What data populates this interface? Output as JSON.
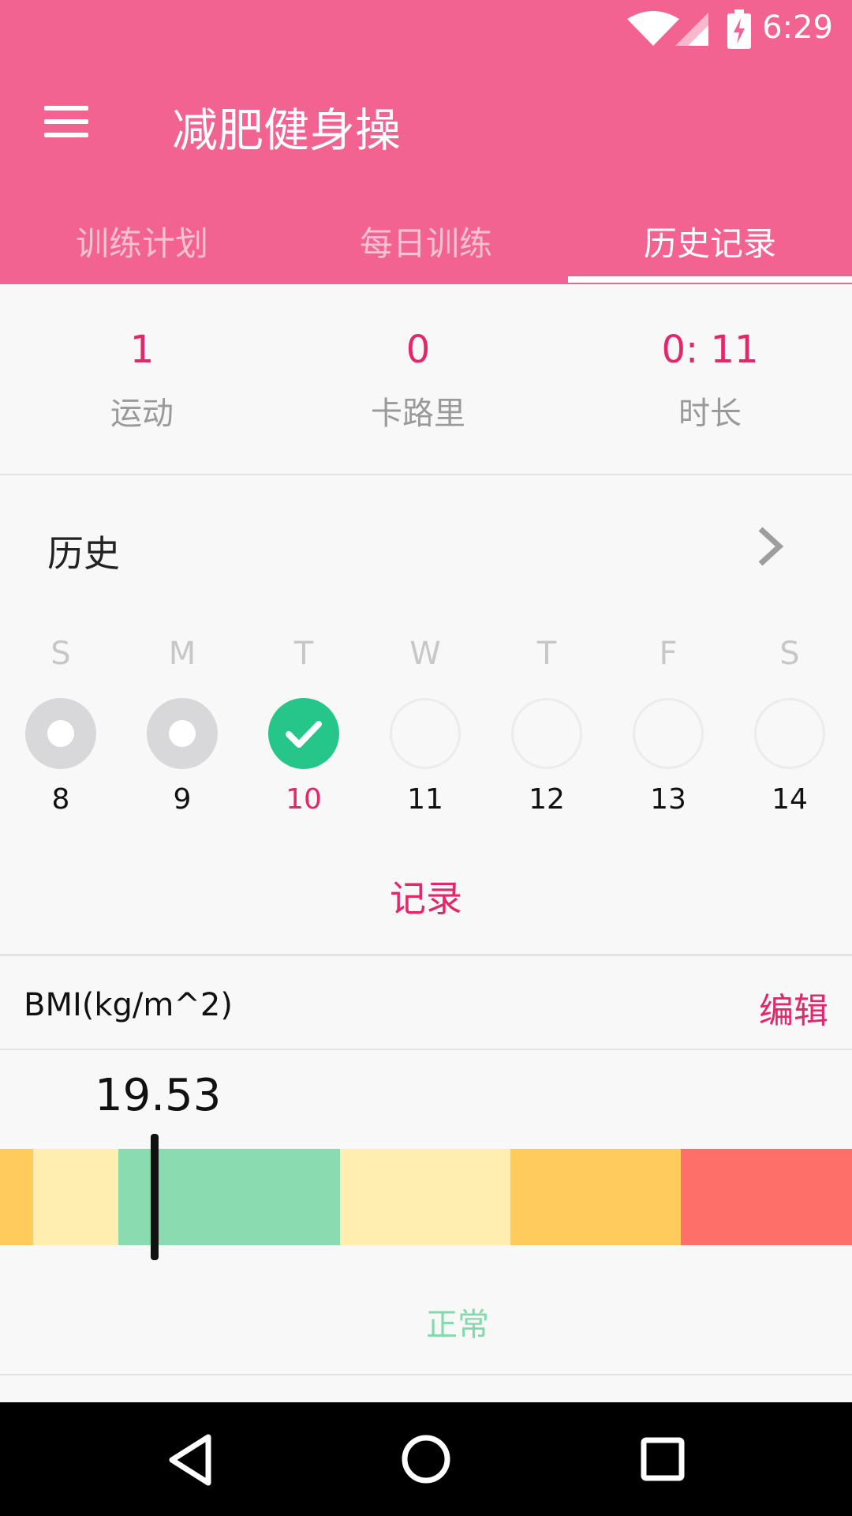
{
  "status_bar": {
    "time": "6:29"
  },
  "app_bar": {
    "title": "减肥健身操"
  },
  "tabs": [
    {
      "label": "训练计划",
      "active": false
    },
    {
      "label": "每日训练",
      "active": false
    },
    {
      "label": "历史记录",
      "active": true
    }
  ],
  "stats": [
    {
      "value": "1",
      "label": "运动"
    },
    {
      "value": "0",
      "label": "卡路里"
    },
    {
      "value": "0: 11",
      "label": "时长"
    }
  ],
  "history": {
    "title": "历史",
    "weekdays": [
      "S",
      "M",
      "T",
      "W",
      "T",
      "F",
      "S"
    ],
    "days": [
      {
        "num": "8",
        "state": "partial"
      },
      {
        "num": "9",
        "state": "partial"
      },
      {
        "num": "10",
        "state": "completed",
        "today": true
      },
      {
        "num": "11",
        "state": "none"
      },
      {
        "num": "12",
        "state": "none"
      },
      {
        "num": "13",
        "state": "none"
      },
      {
        "num": "14",
        "state": "none"
      }
    ],
    "record_label": "记录"
  },
  "bmi": {
    "label": "BMI(kg/m^2)",
    "edit_label": "编辑",
    "value": "19.53",
    "status": "正常",
    "scale_colors": [
      "#ffcb5c",
      "#ffeeb0",
      "#8adbb0",
      "#ffeeb0",
      "#ffcb5c",
      "#ff6f6a"
    ]
  },
  "colors": {
    "accent": "#f26391",
    "highlight": "#e3276a",
    "success": "#26c68a"
  }
}
